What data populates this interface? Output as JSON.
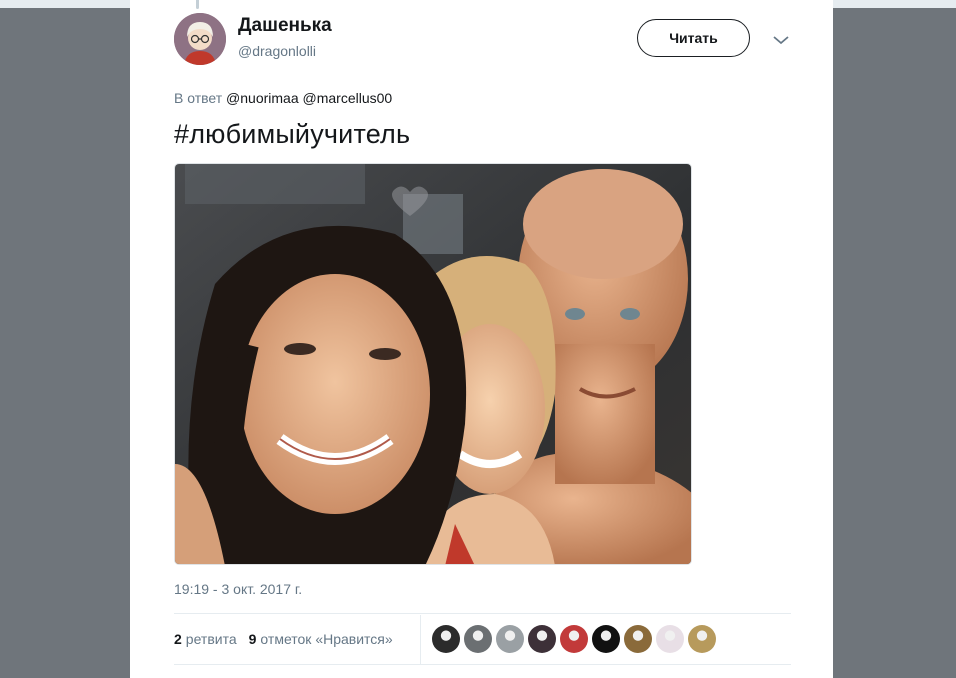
{
  "tweet": {
    "author": {
      "display_name": "Дашенька",
      "screen_name": "@dragonlolli",
      "avatar_icon": "cartoon-girl-avatar-icon"
    },
    "follow_label": "Читать",
    "menu_icon": "chevron-down-icon",
    "reply": {
      "prefix": "В ответ",
      "mentions": [
        "@nuorimaa",
        "@marcellus00"
      ]
    },
    "text": "#любимыйучитель",
    "media": {
      "description_icon": "photo-selfie-image"
    },
    "timestamp": "19:19 - 3 окт. 2017 г.",
    "stats": {
      "retweets_count": "2",
      "retweets_label": "ретвита",
      "likes_count": "9",
      "likes_label": "отметок «Нравится»"
    },
    "likers": [
      {
        "color": "#2b2b2b"
      },
      {
        "color": "#6b6f72"
      },
      {
        "color": "#9aa0a4"
      },
      {
        "color": "#3d3038"
      },
      {
        "color": "#c23a3a"
      },
      {
        "color": "#111111"
      },
      {
        "color": "#8a6a3a"
      },
      {
        "color": "#e8dfe6"
      },
      {
        "color": "#b79a5c"
      }
    ],
    "colors": {
      "text": "#14171a",
      "secondary": "#657786",
      "divider": "#e6ecf0"
    }
  }
}
